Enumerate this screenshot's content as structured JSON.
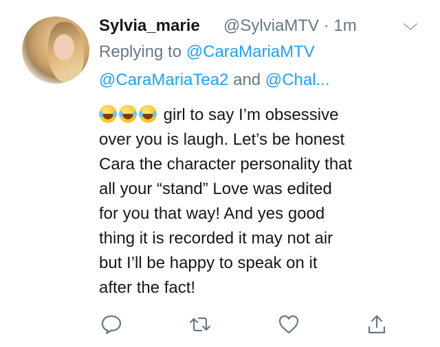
{
  "tweet": {
    "display_name": "Sylvia_marie",
    "handle_time": "@SylviaMTV · 1m",
    "replying_prefix": "Replying to ",
    "mention_1": "@CaraMariaMTV",
    "mention_2": "@CaraMariaTea2",
    "mention_join": " and ",
    "mention_3": "@Chal...",
    "emoji": "face-with-tears-of-joy",
    "emoji_count": 3,
    "text_lines": [
      "girl to say I’m obsessive",
      "over you is laugh. Let’s be honest",
      "Cara the character personality that",
      "all your “stand” Love was edited",
      "for you that way! And yes good",
      "thing it is recorded it may not air",
      "but I’ll be happy to speak on it",
      "after the fact!"
    ]
  },
  "actions": {
    "icons": [
      "reply-icon",
      "retweet-icon",
      "like-icon",
      "share-icon"
    ]
  },
  "colors": {
    "text": "#14171a",
    "secondary": "#657786",
    "link": "#1da1f2",
    "icon": "#657786"
  }
}
